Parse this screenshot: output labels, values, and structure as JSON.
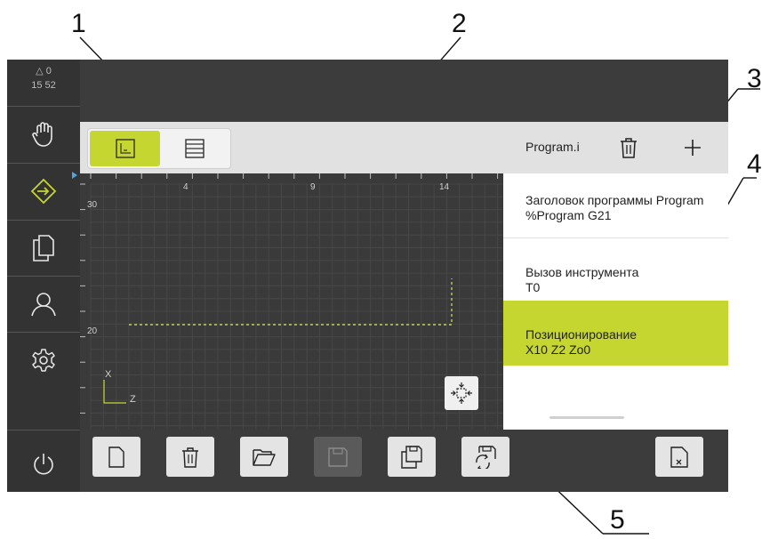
{
  "status": {
    "delta_label": "△ 0",
    "time": "15 52"
  },
  "callouts": [
    "1",
    "2",
    "3",
    "4",
    "5"
  ],
  "sidebar": {
    "items": [
      {
        "icon": "hand-icon",
        "label": "Manual operation"
      },
      {
        "icon": "program-arrow-icon",
        "label": "Programming",
        "active": true
      },
      {
        "icon": "file-icon",
        "label": "File management"
      },
      {
        "icon": "user-icon",
        "label": "User login"
      },
      {
        "icon": "gear-icon",
        "label": "Settings"
      },
      {
        "icon": "power-icon",
        "label": "Switch-off"
      }
    ]
  },
  "view_toggle": {
    "graphic_selected": true,
    "options": [
      "graphic-view-icon",
      "list-view-icon"
    ]
  },
  "graphic": {
    "axis_x_label": "X",
    "axis_z_label": "Z",
    "top_ruler_labels": [
      "4",
      "9",
      "14"
    ],
    "left_ruler_labels": [
      "30",
      "20"
    ],
    "path_color": "#c6d630",
    "fit_icon": "zoom-fit-icon"
  },
  "program_panel": {
    "title": "Program.i",
    "delete_icon": "trash-icon",
    "add_icon": "plus-icon",
    "blocks": [
      {
        "line1": "Заголовок программы Program",
        "line2": "%Program G21",
        "selected": false
      },
      {
        "line1": "Вызов инструмента",
        "line2": "T0",
        "selected": false
      },
      {
        "line1": "Позиционирование",
        "line2": "X10 Z2 Zo0",
        "selected": true
      }
    ]
  },
  "toolbar": {
    "buttons": [
      {
        "icon": "new-file-icon",
        "enabled": true
      },
      {
        "icon": "trash-icon",
        "enabled": true
      },
      {
        "icon": "folder-open-icon",
        "enabled": true
      },
      {
        "icon": "save-icon",
        "enabled": false
      },
      {
        "icon": "save-as-icon",
        "enabled": true
      },
      {
        "icon": "save-refresh-icon",
        "enabled": true
      },
      {
        "icon": "close-file-icon",
        "enabled": true
      }
    ]
  },
  "colors": {
    "accent": "#c6d630",
    "sidebar_bg": "#333333",
    "panel_bg": "#3c3c3c"
  }
}
